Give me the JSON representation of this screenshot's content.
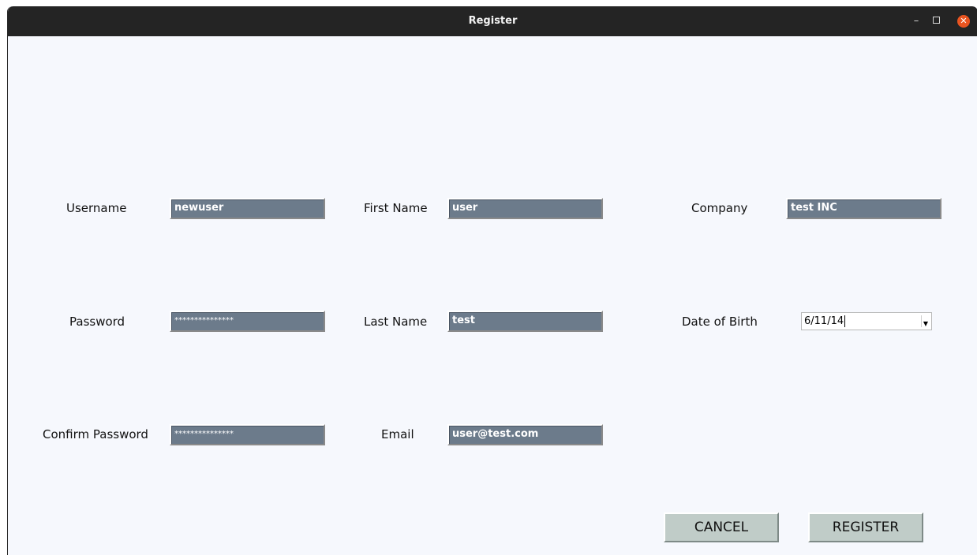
{
  "window": {
    "title": "Register"
  },
  "form": {
    "username": {
      "label": "Username",
      "value": "newuser"
    },
    "password": {
      "label": "Password",
      "value": "***************"
    },
    "confirm_password": {
      "label": "Confirm Password",
      "value": "***************"
    },
    "first_name": {
      "label": "First Name",
      "value": "user"
    },
    "last_name": {
      "label": "Last Name",
      "value": "test"
    },
    "email": {
      "label": "Email",
      "value": "user@test.com"
    },
    "company": {
      "label": "Company",
      "value": "test INC"
    },
    "date_of_birth": {
      "label": "Date of Birth",
      "value": "6/11/14"
    }
  },
  "buttons": {
    "cancel": "CANCEL",
    "register": "REGISTER"
  },
  "icons": {
    "minimize": "minimize-icon",
    "maximize": "maximize-icon",
    "close": "close-icon",
    "dropdown": "chevron-down-icon"
  },
  "colors": {
    "field_bg": "#6c7b8b",
    "button_bg": "#c0ccc8",
    "close_btn": "#e95420",
    "titlebar": "#242424"
  }
}
